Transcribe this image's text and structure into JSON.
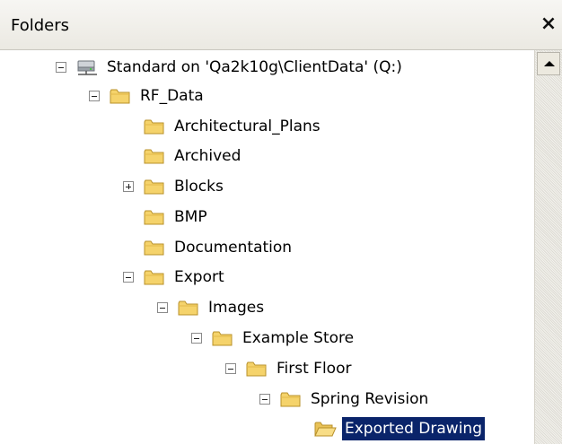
{
  "panel": {
    "title": "Folders",
    "close_glyph": "×"
  },
  "tree": {
    "nodes": [
      {
        "label": "Standard on 'Qa2k10g\\ClientData' (Q:)",
        "toggle": "minus",
        "icon": "network-drive-icon"
      },
      {
        "label": "RF_Data",
        "toggle": "minus",
        "icon": "folder-icon"
      },
      {
        "label": "Architectural_Plans",
        "toggle": "none",
        "icon": "folder-icon"
      },
      {
        "label": "Archived",
        "toggle": "none",
        "icon": "folder-icon"
      },
      {
        "label": "Blocks",
        "toggle": "plus",
        "icon": "folder-icon"
      },
      {
        "label": "BMP",
        "toggle": "none",
        "icon": "folder-icon"
      },
      {
        "label": "Documentation",
        "toggle": "none",
        "icon": "folder-icon"
      },
      {
        "label": "Export",
        "toggle": "minus",
        "icon": "folder-icon"
      },
      {
        "label": "Images",
        "toggle": "minus",
        "icon": "folder-icon"
      },
      {
        "label": "Example Store",
        "toggle": "minus",
        "icon": "folder-icon"
      },
      {
        "label": "First Floor",
        "toggle": "minus",
        "icon": "folder-icon"
      },
      {
        "label": "Spring Revision",
        "toggle": "minus",
        "icon": "folder-icon"
      },
      {
        "label": "Exported Drawing",
        "toggle": "none",
        "icon": "open-folder-icon",
        "selected": true
      }
    ]
  },
  "colors": {
    "selection_bg": "#0a246a",
    "folder_fill": "#f5d36b",
    "folder_stroke": "#b8902a"
  }
}
